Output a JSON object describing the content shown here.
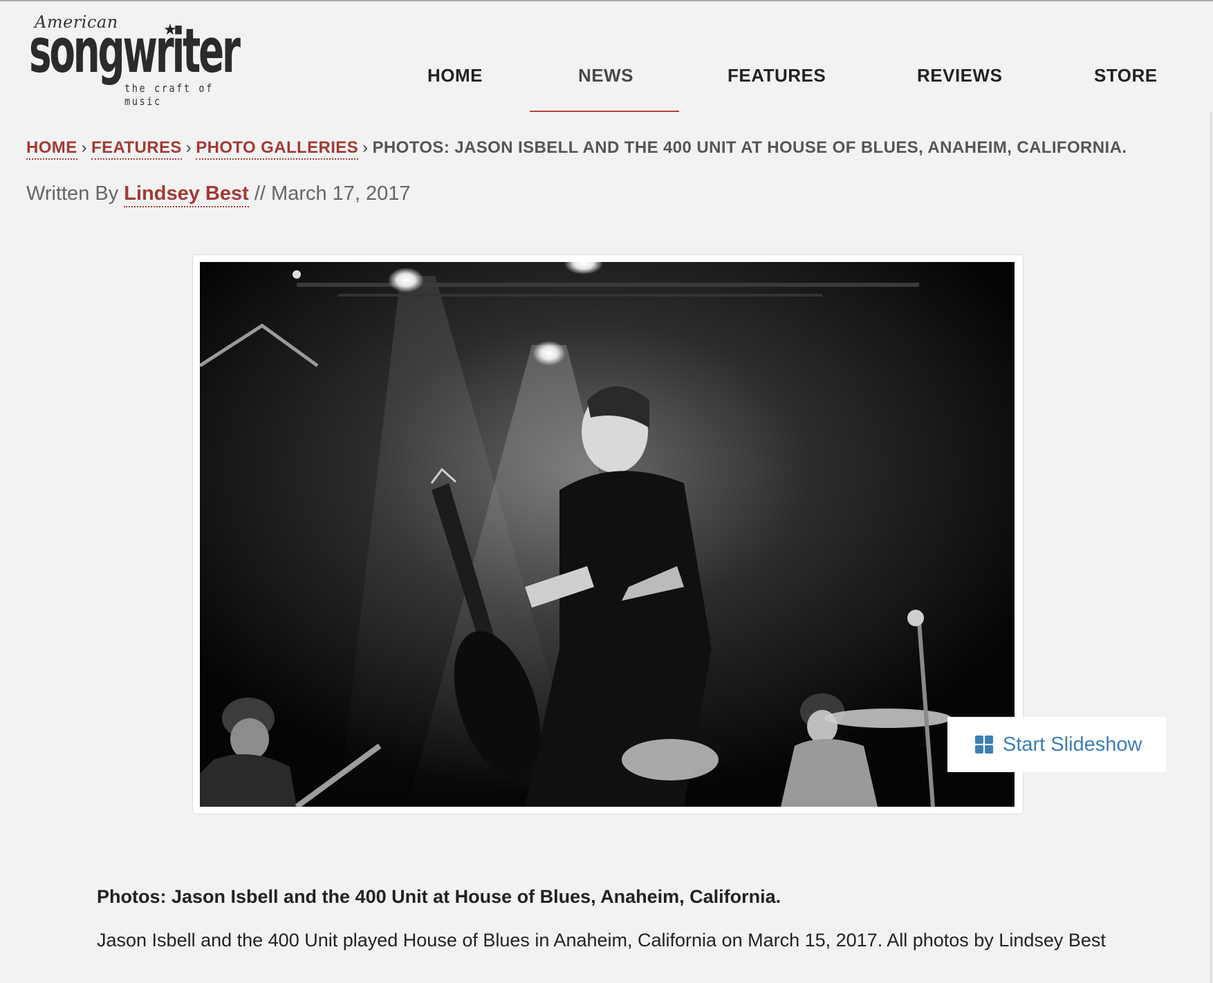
{
  "logo": {
    "script": "American",
    "wordmark": "songwriter",
    "tagline": "the craft of music"
  },
  "nav": {
    "items": [
      {
        "label": "HOME"
      },
      {
        "label": "NEWS",
        "active": true
      },
      {
        "label": "FEATURES"
      },
      {
        "label": "REVIEWS"
      },
      {
        "label": "STORE"
      }
    ]
  },
  "breadcrumb": {
    "home": "HOME",
    "features": "FEATURES",
    "photo_galleries": "PHOTO GALLERIES",
    "separator": "›",
    "current": "PHOTOS: JASON ISBELL AND THE 400 UNIT AT HOUSE OF BLUES, ANAHEIM, CALIFORNIA."
  },
  "byline": {
    "prefix": "Written By",
    "author": "Lindsey Best",
    "divider": "//",
    "date": "March 17, 2017"
  },
  "gallery": {
    "slideshow_label": "Start Slideshow",
    "slideshow_icon": "grid-icon"
  },
  "article": {
    "title": "Photos: Jason Isbell and the 400 Unit at House of Blues, Anaheim, California.",
    "body": "Jason Isbell and the 400 Unit played House of Blues in Anaheim, California on March 15, 2017. All photos by Lindsey Best"
  },
  "colors": {
    "accent_red": "#a23a36",
    "link_blue": "#3d7fb3",
    "background": "#f2f2f2"
  }
}
